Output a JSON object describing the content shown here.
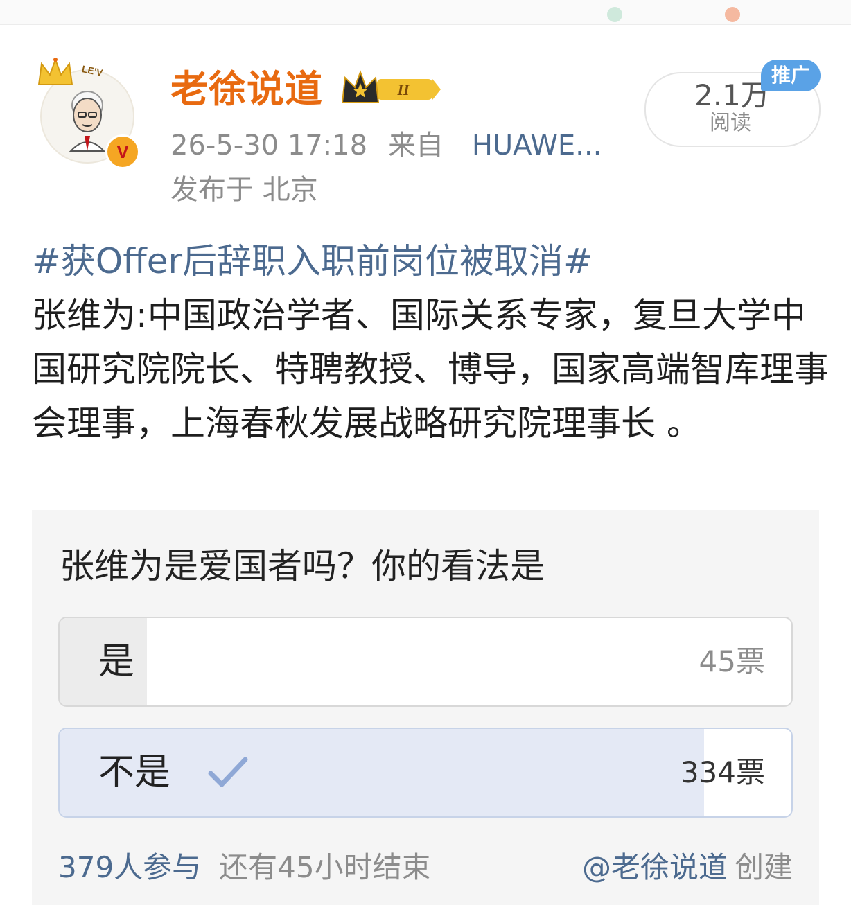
{
  "post": {
    "author": "老徐说道",
    "member_level": "II",
    "avatar_tag": "LE'V",
    "verified_mark": "V",
    "time": "26-5-30 17:18",
    "from_label": "来自",
    "device": "HUAWE...",
    "location": "发布于 北京",
    "read_count": "2.1万",
    "read_label": "阅读",
    "promo_label": "推广",
    "hashtag": "#获Offer后辞职入职前岗位被取消#",
    "body": "张维为:中国政治学者、国际关系专家，复旦大学中国研究院院长、特聘教授、博导，国家高端智库理事会理事，上海春秋发展战略研究院理事长 。"
  },
  "poll": {
    "question": "张维为是爱国者吗？你的看法是",
    "options": [
      {
        "label": "是",
        "votes": "45票",
        "fraction": 0.119,
        "selected": false
      },
      {
        "label": "不是",
        "votes": "334票",
        "fraction": 0.881,
        "selected": true
      }
    ],
    "participants": "379人参与",
    "time_left": "还有45小时结束",
    "creator": "@老徐说道",
    "created_label": "创建"
  },
  "colors": {
    "username": "#e86a10",
    "link": "#4c6a8f",
    "promo": "#5aa2e6",
    "selected_fill": "#e4e9f5"
  }
}
